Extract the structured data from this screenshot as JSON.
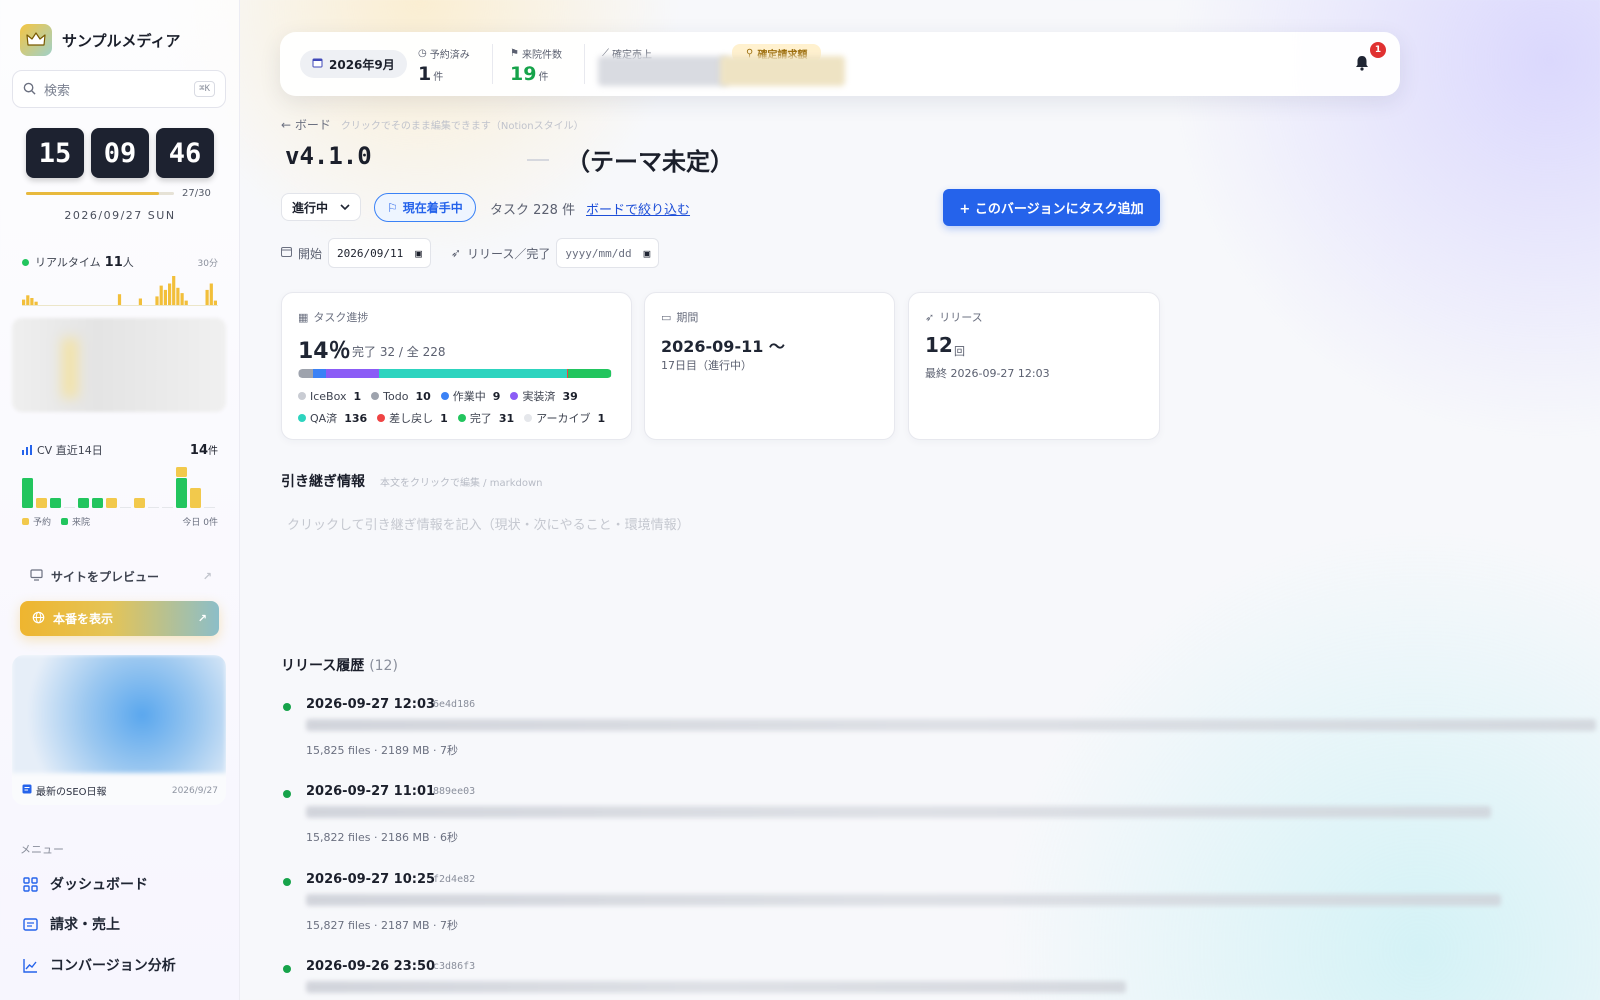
{
  "sidebar": {
    "brand": "サンプルメディア",
    "search": {
      "placeholder": "検索",
      "shortcut": "⌘K"
    },
    "clock": {
      "hh": "15",
      "mm": "09",
      "ss": "46",
      "day_progress": 0.9,
      "day_count": "27/30",
      "date": "2026/09/27 SUN"
    },
    "realtime": {
      "label": "リアルタイム",
      "count": "11",
      "unit": "人",
      "window": "30分",
      "bars": [
        12,
        20,
        15,
        8,
        0,
        0,
        0,
        0,
        0,
        0,
        0,
        0,
        0,
        0,
        0,
        0,
        0,
        0,
        0,
        0,
        0,
        0,
        0,
        22,
        0,
        0,
        0,
        0,
        14,
        0,
        0,
        0,
        18,
        38,
        30,
        42,
        56,
        34,
        24,
        10,
        0,
        0,
        0,
        0,
        30,
        42,
        10
      ]
    },
    "cv": {
      "label": "CV 直近14日",
      "total": "14",
      "unit": "件",
      "days": [
        {
          "booking": 0,
          "visit": 3
        },
        {
          "booking": 1,
          "visit": 0
        },
        {
          "booking": 0,
          "visit": 1
        },
        {
          "booking": 0,
          "visit": 0
        },
        {
          "booking": 0,
          "visit": 1
        },
        {
          "booking": 0,
          "visit": 1
        },
        {
          "booking": 1,
          "visit": 0
        },
        {
          "booking": 0,
          "visit": 0
        },
        {
          "booking": 1,
          "visit": 0
        },
        {
          "booking": 0,
          "visit": 0
        },
        {
          "booking": 0,
          "visit": 0
        },
        {
          "booking": 1,
          "visit": 3
        },
        {
          "booking": 2,
          "visit": 0
        },
        {
          "booking": 0,
          "visit": 0
        }
      ],
      "legend_booking": "予約",
      "legend_visit": "来院",
      "today": "今日 0件"
    },
    "preview_label": "サイトをプレビュー",
    "production_label": "本番を表示",
    "seo": {
      "title": "最新のSEO日報",
      "date": "2026/9/27"
    },
    "menu_heading": "メニュー",
    "menu": [
      {
        "label": "ダッシュボード",
        "icon": "grid-icon"
      },
      {
        "label": "請求・売上",
        "icon": "invoice-icon"
      },
      {
        "label": "コンバージョン分析",
        "icon": "chart-icon"
      }
    ]
  },
  "topbar": {
    "month": "2026年9月",
    "booked": {
      "label": "予約済み",
      "value": "1",
      "unit": "件"
    },
    "visits": {
      "label": "来院件数",
      "value": "19",
      "unit": "件"
    },
    "sales": {
      "label": "確定売上"
    },
    "invoice": {
      "label": "確定請求額"
    },
    "notifications": "1"
  },
  "main": {
    "back": "← ボード",
    "hint": "クリックでそのまま編集できます（Notionスタイル）",
    "version": "v4.1.0",
    "theme": "（テーマ未定）",
    "status": "進行中",
    "current_button": "現在着手中",
    "task_count": "タスク 228 件",
    "filter_link": "ボードで絞り込む",
    "add_task": "+ このバージョンにタスク追加",
    "start_label": "開始",
    "start_value": "2026/09/11",
    "release_label": "リリース／完了",
    "release_placeholder": "yyyy/mm/dd"
  },
  "progress_card": {
    "label": "タスク進捗",
    "percent": "14％",
    "sub": "完了 32 / 全 228",
    "segments": [
      {
        "name": "IceBox",
        "count": 1,
        "color": "#c9ccd3"
      },
      {
        "name": "Todo",
        "count": 10,
        "color": "#9ea3ad"
      },
      {
        "name": "作業中",
        "count": 9,
        "color": "#3b82f6"
      },
      {
        "name": "実装済",
        "count": 39,
        "color": "#8b5cf6"
      },
      {
        "name": "QA済",
        "count": 136,
        "color": "#2dd4bf"
      },
      {
        "name": "差し戻し",
        "count": 1,
        "color": "#ef4444"
      },
      {
        "name": "完了",
        "count": 31,
        "color": "#22c55e"
      },
      {
        "name": "アーカイブ",
        "count": 1,
        "color": "#e5e7eb"
      }
    ]
  },
  "period_card": {
    "label": "期間",
    "main": "2026-09-11 〜",
    "sub": "17日目（進行中）"
  },
  "release_card": {
    "label": "リリース",
    "count": "12",
    "unit": "回",
    "last": "最終 2026-09-27 12:03"
  },
  "handoff": {
    "title": "引き継ぎ情報",
    "hint": "本文をクリックで編集 / markdown",
    "placeholder": "クリックして引き継ぎ情報を記入（現状・次にやること・環境情報）"
  },
  "history": {
    "title": "リリース履歴",
    "count": "(12)",
    "items": [
      {
        "time": "2026-09-27 12:03",
        "hash": "6e4d186",
        "meta": "15,825 files · 2189 MB · 7秒"
      },
      {
        "time": "2026-09-27 11:01",
        "hash": "889ee03",
        "meta": "15,822 files · 2186 MB · 6秒"
      },
      {
        "time": "2026-09-27 10:25",
        "hash": "f2d4e82",
        "meta": "15,827 files · 2187 MB · 7秒"
      },
      {
        "time": "2026-09-26 23:50",
        "hash": "c3d86f3",
        "meta": ""
      }
    ]
  }
}
